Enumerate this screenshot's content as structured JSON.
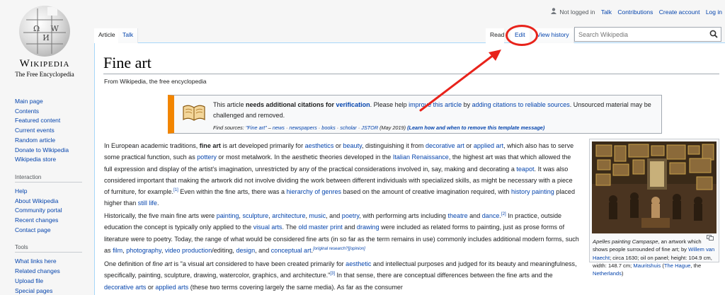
{
  "logo": {
    "glyphs": "Ω  W  И",
    "wordmark": "Wikipedia",
    "tagline": "The Free Encyclopedia"
  },
  "personal": {
    "not_logged_in": "Not logged in",
    "talk": "Talk",
    "contributions": "Contributions",
    "create_account": "Create account",
    "log_in": "Log in"
  },
  "tabs": {
    "article": "Article",
    "talk": "Talk",
    "read": "Read",
    "edit": "Edit",
    "view_history": "View history"
  },
  "search": {
    "placeholder": "Search Wikipedia",
    "icon": "search-icon"
  },
  "sidebar": {
    "main": [
      "Main page",
      "Contents",
      "Featured content",
      "Current events",
      "Random article",
      "Donate to Wikipedia",
      "Wikipedia store"
    ],
    "interaction_heading": "Interaction",
    "interaction": [
      "Help",
      "About Wikipedia",
      "Community portal",
      "Recent changes",
      "Contact page"
    ],
    "tools_heading": "Tools",
    "tools": [
      "What links here",
      "Related changes",
      "Upload file",
      "Special pages"
    ]
  },
  "page": {
    "title": "Fine art",
    "subtitle": "From Wikipedia, the free encyclopedia"
  },
  "ambox": {
    "t1": "This article ",
    "t2": "needs additional citations for ",
    "t3": "verification",
    "t4": ". Please help ",
    "t5": "improve this article",
    "t6": " by ",
    "t7": "adding citations to reliable sources",
    "t8": ". Unsourced material may be challenged and removed.",
    "s1": "Find sources: ",
    "s2": "\"Fine art\"",
    "s3": " – ",
    "s4": "news",
    "s5": " · ",
    "s6": "newspapers",
    "s7": " · ",
    "s8": "books",
    "s9": " · ",
    "s10": "scholar",
    "s11": " · ",
    "s12": "JSTOR",
    "s13": " (May 2019) ",
    "s14": "(Learn how and when to remove this template message)",
    "accent": "#f28500"
  },
  "p1": {
    "a": "In European academic traditions, ",
    "b": "fine art",
    "c": " is art developed primarily for ",
    "d": "aesthetics",
    "e": " or ",
    "f": "beauty",
    "g": ", distinguishing it from ",
    "h": "decorative art",
    "i": " or ",
    "j": "applied art",
    "k": ", which also has to serve some practical function, such as ",
    "l": "pottery",
    "m": " or most metalwork. In the aesthetic theories developed in the ",
    "n": "Italian Renaissance",
    "o": ", the highest art was that which allowed the full expression and display of the artist's imagination, unrestricted by any of the practical considerations involved in, say, making and decorating a ",
    "p": "teapot",
    "q": ". It was also considered important that making the artwork did not involve dividing the work between different individuals with specialized skills, as might be necessary with a piece of furniture, for example.",
    "r": "[1]",
    "s": " Even within the fine arts, there was a ",
    "t": "hierarchy of genres",
    "u": " based on the amount of creative imagination required, with ",
    "v": "history painting",
    "w": " placed higher than ",
    "x": "still life",
    "y": "."
  },
  "p2": {
    "a": "Historically, the five main fine arts were ",
    "b": "painting",
    "c": ", ",
    "d": "sculpture",
    "e": ", ",
    "f": "architecture",
    "g": ", ",
    "h": "music",
    "i": ", and ",
    "j": "poetry",
    "k": ", with performing arts including ",
    "l": "theatre",
    "m": " and ",
    "n": "dance",
    "o": ".",
    "p": "[2]",
    "q": " In practice, outside education the concept is typically only applied to the ",
    "r": "visual arts",
    "s": ". The ",
    "t": "old master print",
    "u": " and ",
    "v": "drawing",
    "w": " were included as related forms to painting, just as prose forms of literature were to poetry. Today, the range of what would be considered fine arts (in so far as the term remains in use) commonly includes additional modern forms, such as ",
    "x": "film",
    "y": ", ",
    "z": "photography",
    "aa": ", ",
    "ab": "video production",
    "ac": "/editing, ",
    "ad": "design",
    "ae": ", and ",
    "af": "conceptual art",
    "ag": ".",
    "ah": "[original research?]",
    "ai": "[opinion]"
  },
  "p3": {
    "a": "One definition of ",
    "b": "fine art",
    "c": " is \"a visual art considered to have been created primarily for ",
    "d": "aesthetic",
    "e": " and intellectual purposes and judged for its beauty and meaningfulness, specifically, painting, sculpture, drawing, watercolor, graphics, and architecture.\"",
    "f": "[3]",
    "g": " In that sense, there are conceptual differences between the fine arts and the ",
    "h": "decorative arts",
    "i": " or ",
    "j": "applied arts",
    "k": " (these two terms covering largely the same media). As far as the consumer"
  },
  "infobox": {
    "c1": "Apelles painting Campaspe",
    "c2": ", an artwork which shows people surrounded of fine art; by ",
    "c3": "Willem van Haecht",
    "c4": "; circa 1630; oil on panel; height: 104.9 cm, width: 148.7 cm; ",
    "c5": "Mauritshuis",
    "c6": " (",
    "c7": "The Hague",
    "c8": ", the ",
    "c9": "Netherlands",
    "c10": ")"
  },
  "annotation": {
    "color": "#e8231b"
  }
}
